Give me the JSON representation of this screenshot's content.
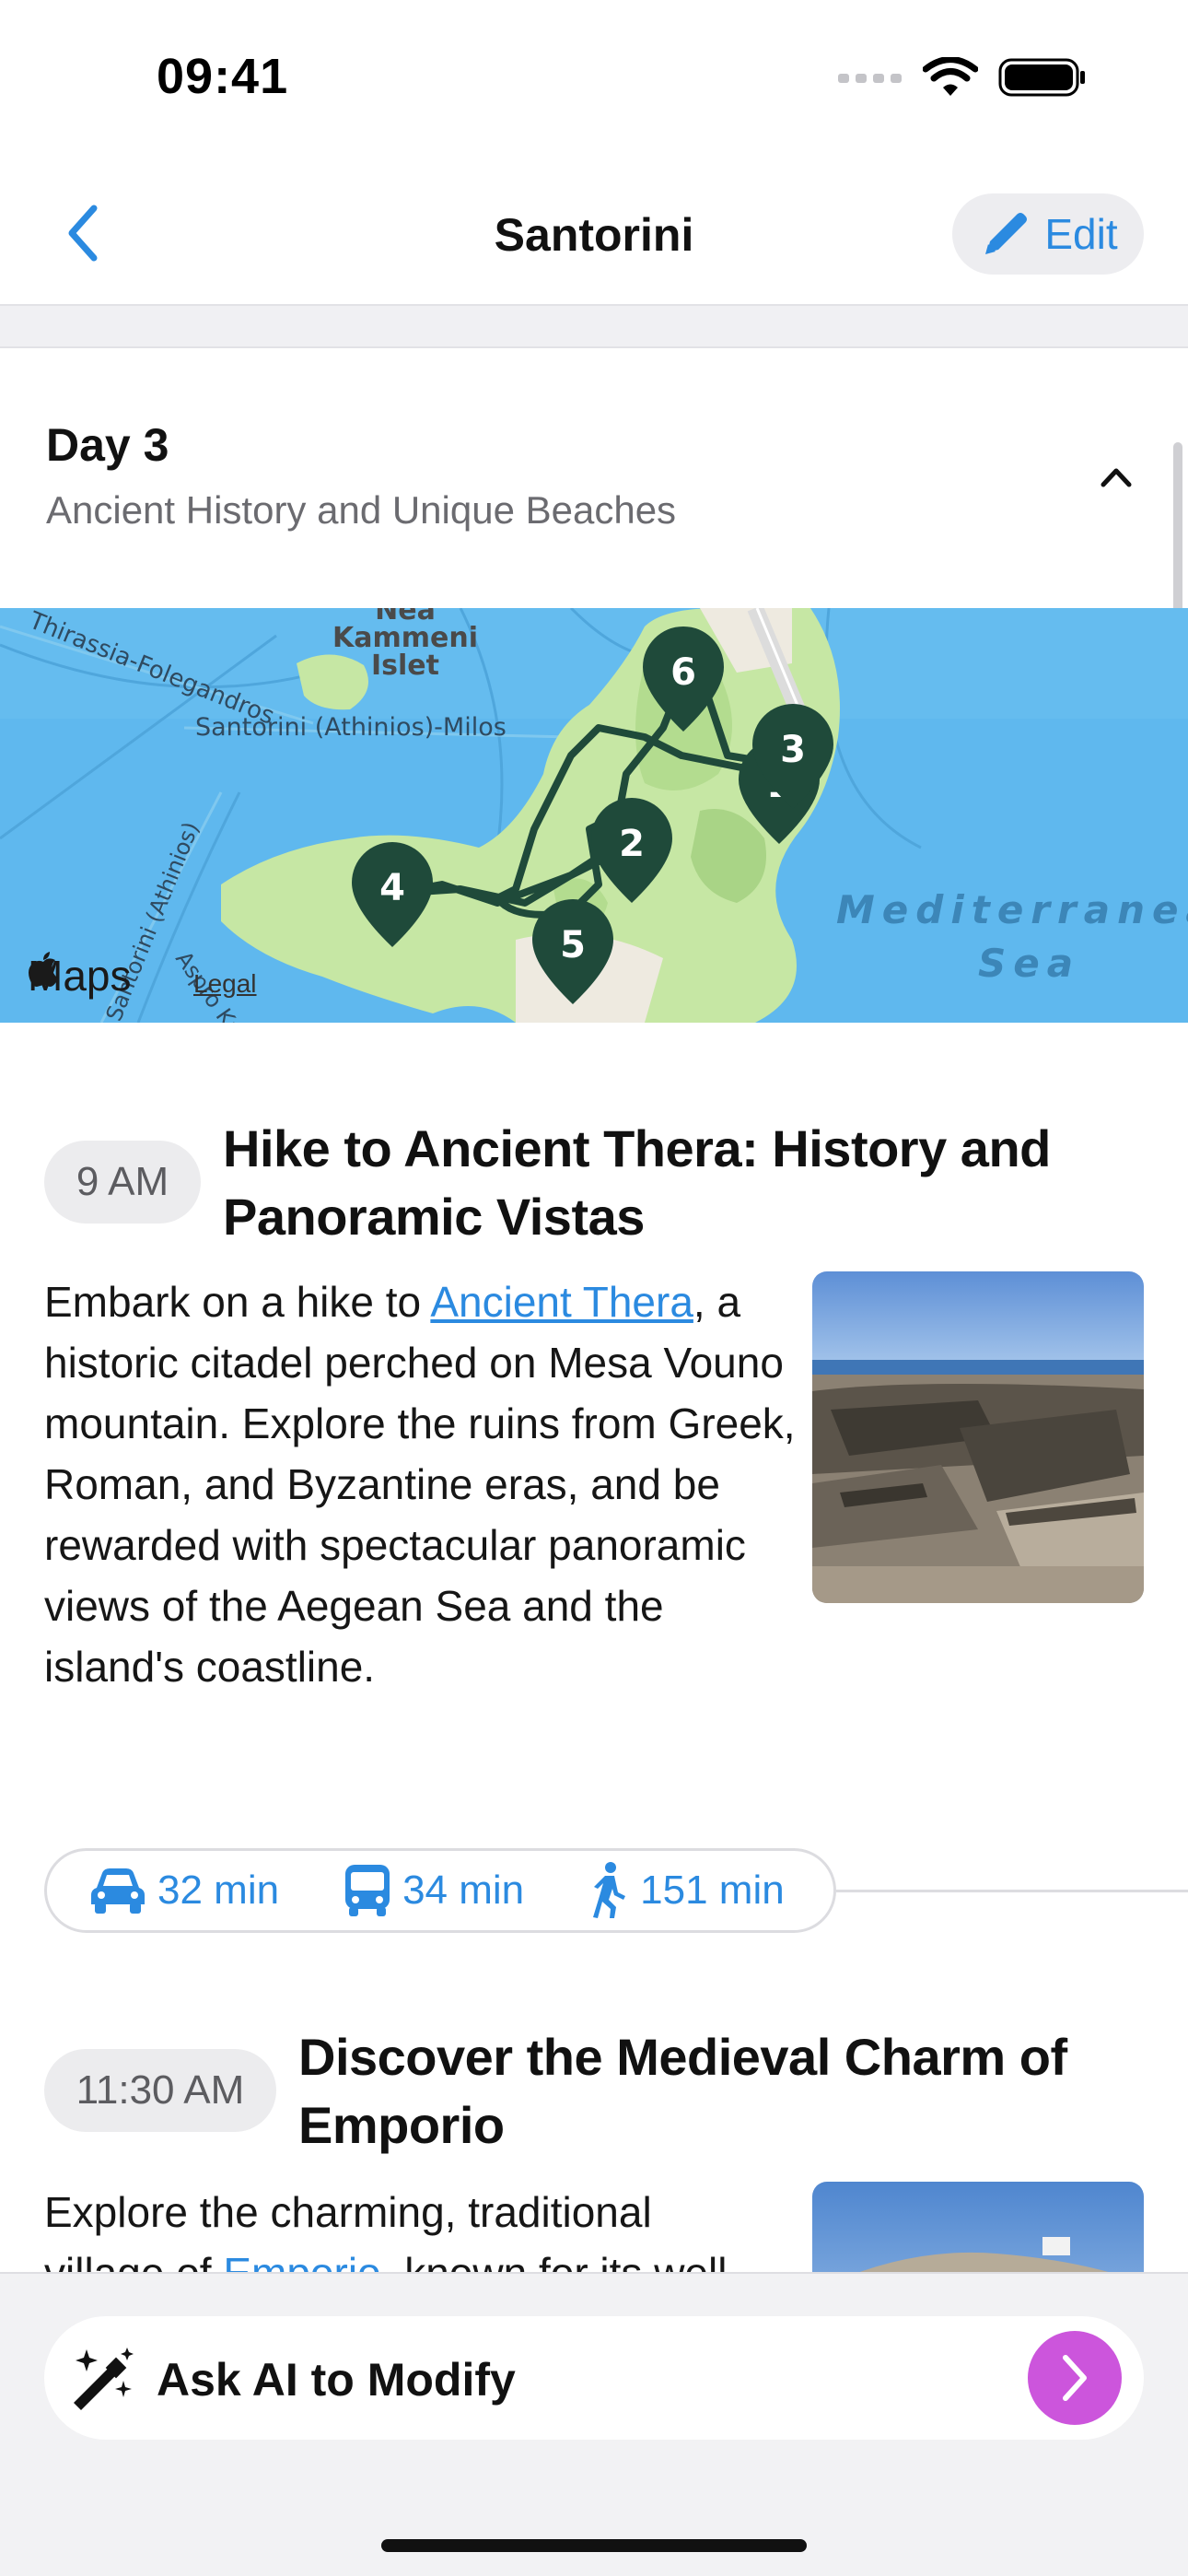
{
  "status_bar": {
    "time": "09:41"
  },
  "nav": {
    "title": "Santorini",
    "edit_label": "Edit"
  },
  "day": {
    "title": "Day 3",
    "subtitle": "Ancient History and Unique Beaches"
  },
  "map": {
    "attribution": "Maps",
    "legal": "Legal",
    "labels": {
      "nea_kammeni_1": "Nea",
      "nea_kammeni_2": "Kammeni",
      "nea_kammeni_3": "Islet",
      "route_label": "Santorini (Athinios)-Milos",
      "folegandros": "Thirassia-Folegandros",
      "athinios": "Santorini (Athinios)",
      "aspro": "Aspro Kavos",
      "sea_1": "Mediterranean",
      "sea_2": "Sea"
    },
    "pins": [
      "6",
      "3",
      "1",
      "2",
      "4",
      "5"
    ],
    "colors": {
      "water": "#5fb8ee",
      "land": "#c6e7a4",
      "pin": "#1f4a3a"
    }
  },
  "activities": [
    {
      "time": "9 AM",
      "title_line1": "Hike to Ancient Thera: History and",
      "title_line2": "Panoramic Vistas",
      "desc_before": "Embark on a hike to ",
      "desc_link": "Ancient Thera",
      "desc_after": ", a historic citadel perched on Mesa Vouno mountain. Explore the ruins from Greek, Roman, and Byzantine eras, and be rewarded with spectacular panoramic views of the Aegean Sea and the island's coastline."
    },
    {
      "time": "11:30 AM",
      "title_line1": "Discover the Medieval Charm of",
      "title_line2": "Emporio",
      "desc_line1": "Explore the charming, traditional",
      "desc_line2_before": "village of ",
      "desc_line2_link": "Emporio",
      "desc_line2_after": ", known for its well"
    }
  ],
  "travel": {
    "car": "32 min",
    "bus": "34 min",
    "walk": "151 min"
  },
  "bottom": {
    "ai_label": "Ask AI to Modify"
  },
  "colors": {
    "accent": "#2b8ae0",
    "ai_button": "#cc55dc"
  }
}
